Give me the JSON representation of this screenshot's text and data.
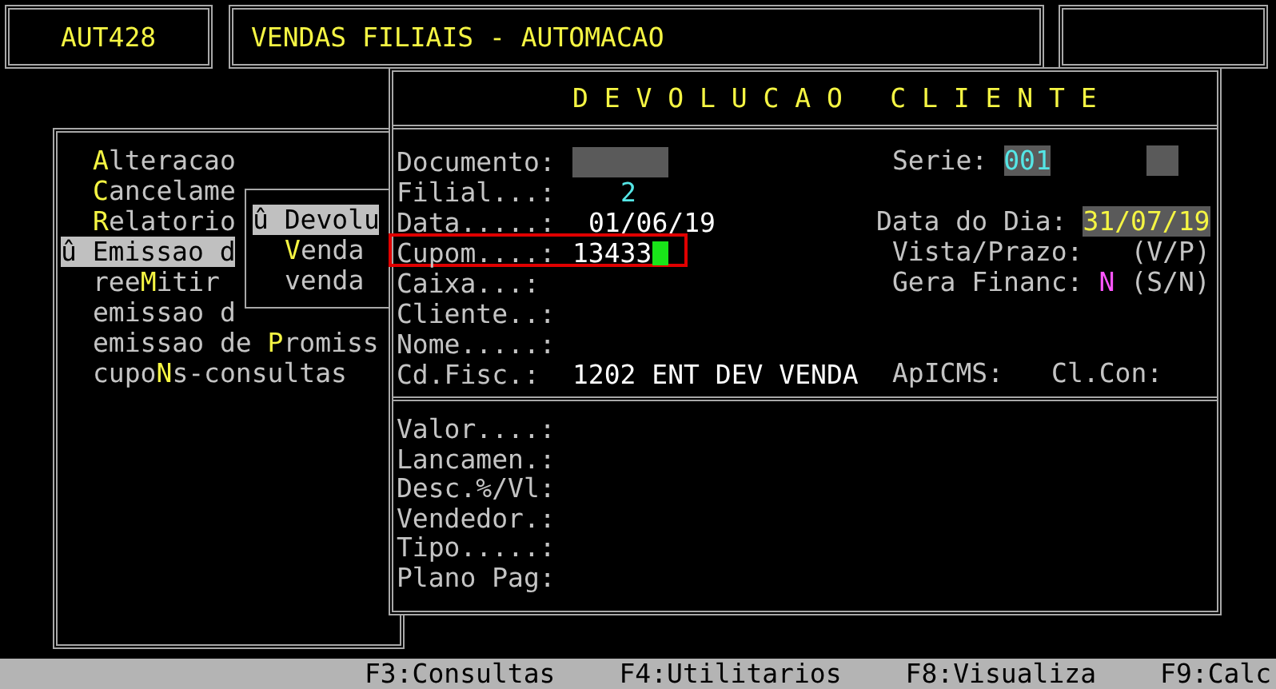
{
  "header": {
    "program": "AUT428",
    "title": "VENDAS FILIAIS - AUTOMACAO"
  },
  "menu": {
    "items": [
      {
        "hotkey": "A",
        "after": "lteracao",
        "selected": false
      },
      {
        "hotkey": "C",
        "after": "ancelame",
        "selected": false
      },
      {
        "hotkey": "R",
        "after": "elatorio",
        "selected": false
      },
      {
        "marker": "û",
        "before": "Emissao d",
        "selected": true
      },
      {
        "before": "ree",
        "hotkey": "M",
        "after": "itir",
        "selected": false
      },
      {
        "before": "emissao d",
        "selected": false
      },
      {
        "before": "emissao de ",
        "hotkey": "P",
        "after": "romiss",
        "selected": false
      },
      {
        "before": "cupo",
        "hotkey": "N",
        "after": "s-consultas",
        "selected": false
      }
    ]
  },
  "submenu": {
    "items": [
      {
        "marker": "û",
        "before": "Devolu",
        "selected": true
      },
      {
        "hotkey": "V",
        "after": "enda",
        "selected": false
      },
      {
        "before": "venda",
        "selected": false
      }
    ]
  },
  "dialog": {
    "title": "D E V O L U C A O   C L I E N T E",
    "rows": [
      {
        "left": {
          "label": "Documento:",
          "kind": "field"
        },
        "right": [
          {
            "label": "Serie:",
            "value": "001",
            "kind": "field"
          },
          {
            "kind": "field"
          }
        ]
      },
      {
        "left": {
          "label": "Filial...:",
          "value": "2",
          "kind": "numeric"
        }
      },
      {
        "left": {
          "label": "Data.....:",
          "value": "01/06/19",
          "kind": "text"
        },
        "right": [
          {
            "label": "Data do Dia:",
            "value": "31/07/19",
            "kind": "today"
          }
        ]
      },
      {
        "left": {
          "label": "Cupom....:",
          "value": "13433",
          "kind": "text",
          "cursor": true,
          "highlighted": true
        },
        "right": [
          {
            "label": "Vista/Prazo:",
            "hint": "(V/P)",
            "kind": "option"
          }
        ]
      },
      {
        "left": {
          "label": "Caixa...:",
          "kind": "text"
        },
        "right": [
          {
            "label": "Gera Financ:",
            "value": "N",
            "hint": "(S/N)",
            "kind": "option"
          }
        ]
      },
      {
        "left": {
          "label": "Cliente..:",
          "kind": "text"
        }
      },
      {
        "left": {
          "label": "Nome.....:",
          "kind": "text"
        }
      },
      {
        "left": {
          "label": "Cd.Fisc.:",
          "value": "1202 ENT DEV VENDA",
          "kind": "text"
        },
        "right": [
          {
            "label": "ApICMS:",
            "kind": "text"
          },
          {
            "label": "Cl.Con:",
            "kind": "text"
          }
        ]
      }
    ],
    "bottom_labels": [
      "Valor....:",
      "Lancamen.:",
      "Desc.%/Vl:",
      "Vendedor.:",
      "Tipo.....:",
      "Plano Pag:"
    ]
  },
  "status_bar": [
    "F3:Consultas",
    "F4:Utilitarios",
    "F8:Visualiza",
    "F9:Calc"
  ]
}
